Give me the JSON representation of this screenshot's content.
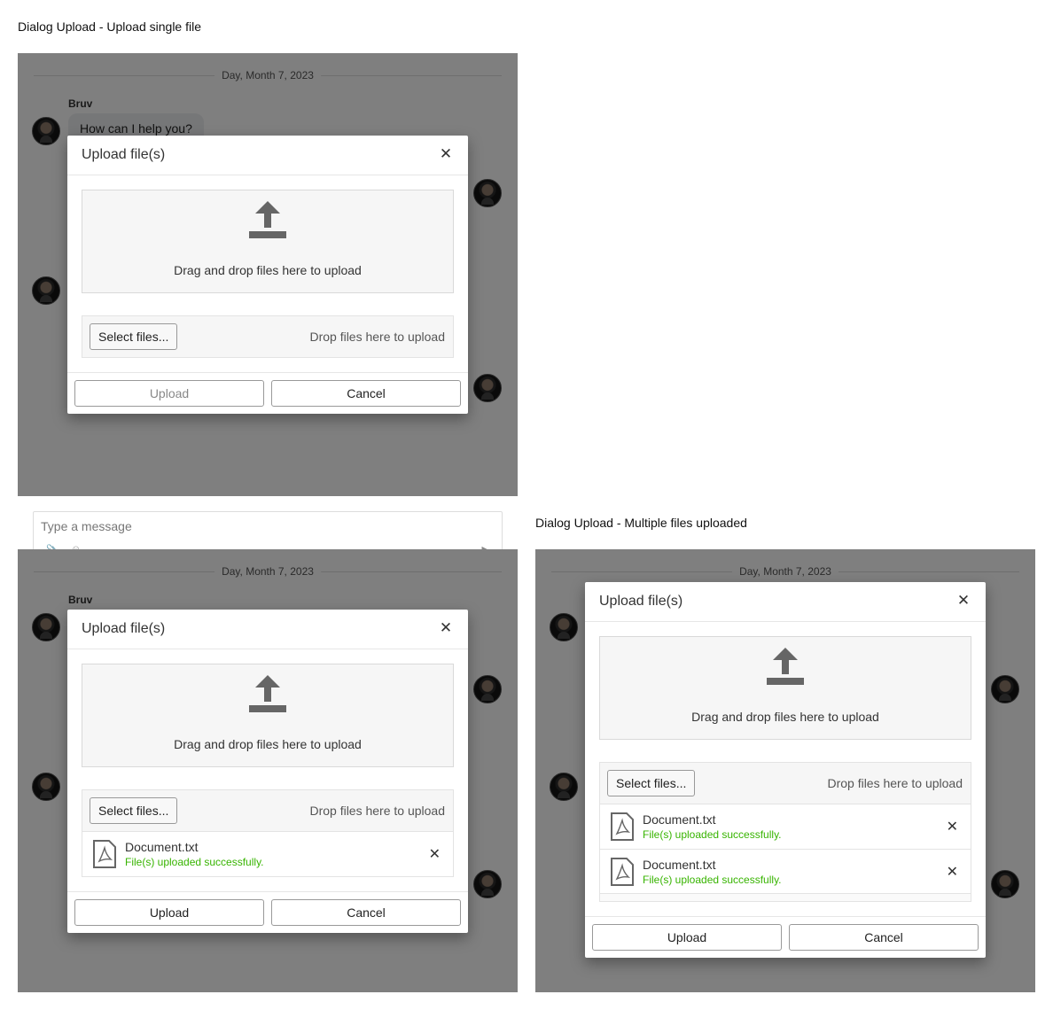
{
  "screens": [
    {
      "title": "Dialog Upload - Upload single file",
      "chat": {
        "date": "Day, Month 7, 2023",
        "sender": "Bruv",
        "message": "How can I help you?",
        "composer_placeholder": "Type a message"
      },
      "dialog": {
        "title": "Upload file(s)",
        "dropzone_text": "Drag and drop files here to upload",
        "select_label": "Select files...",
        "drop_hint": "Drop files here to upload",
        "files": [],
        "upload_label": "Upload",
        "upload_enabled": false,
        "cancel_label": "Cancel"
      }
    },
    {
      "title": "",
      "chat": {
        "date": "Day, Month 7, 2023",
        "sender": "Bruv",
        "message": "",
        "composer_placeholder": ""
      },
      "dialog": {
        "title": "Upload file(s)",
        "dropzone_text": "Drag and drop files here to upload",
        "select_label": "Select files...",
        "drop_hint": "Drop files here to upload",
        "files": [
          {
            "name": "Document.txt",
            "status": "File(s) uploaded successfully."
          }
        ],
        "upload_label": "Upload",
        "upload_enabled": true,
        "cancel_label": "Cancel"
      }
    },
    {
      "title": "Dialog Upload - Multiple files uploaded",
      "chat": {
        "date": "Day, Month 7, 2023",
        "sender": "",
        "message": "",
        "composer_placeholder": ""
      },
      "dialog": {
        "title": "Upload file(s)",
        "dropzone_text": "Drag and drop files here to upload",
        "select_label": "Select files...",
        "drop_hint": "Drop files here to upload",
        "files": [
          {
            "name": "Document.txt",
            "status": "File(s) uploaded successfully."
          },
          {
            "name": "Document.txt",
            "status": "File(s) uploaded successfully."
          }
        ],
        "upload_label": "Upload",
        "upload_enabled": true,
        "cancel_label": "Cancel"
      }
    }
  ],
  "colors": {
    "overlay": "rgba(0,0,0,0.5)",
    "success_text": "#37b400",
    "icon_gray": "#666666"
  },
  "icons": {
    "upload": "upload-arrow-icon",
    "close": "close-icon",
    "file": "pdf-file-icon",
    "remove": "remove-x-icon"
  }
}
